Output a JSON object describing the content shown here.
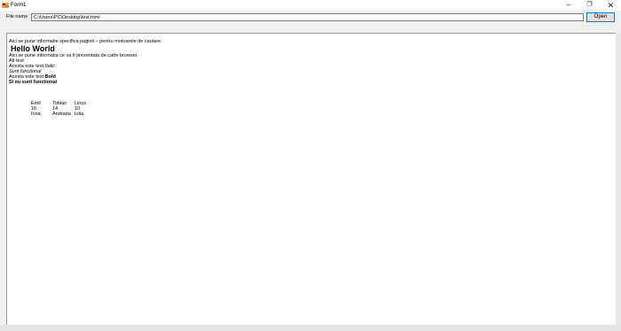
{
  "window": {
    "title": "Form1",
    "controls": {
      "minimize": "–",
      "maximize": "❐",
      "close": "✕"
    }
  },
  "toolbar": {
    "file_label": "File name",
    "file_path": "C:\\Users\\PC\\Desktop\\test.html",
    "open_label": "Open"
  },
  "page": {
    "meta_text": "Aici se pune informatie specifica paginii – pentru motoarele de cautare.",
    "heading": "Hello World",
    "line1": "Aici se pune informatia ce va fi prezentata de catre browser.",
    "line2": "Alt text",
    "italic_prefix": "Acesta este text ",
    "italic_word": "Italic",
    "italic_line": "Sunt functional",
    "bold_prefix": "Acesta este text ",
    "bold_word": "Bold",
    "bold_line": "Si eu sunt functional"
  },
  "table": {
    "rows": [
      [
        "Emil",
        "Tobias",
        "Linus"
      ],
      [
        "16",
        "14",
        "10"
      ],
      [
        "Irina",
        "Andrada",
        "Iulia"
      ]
    ]
  }
}
